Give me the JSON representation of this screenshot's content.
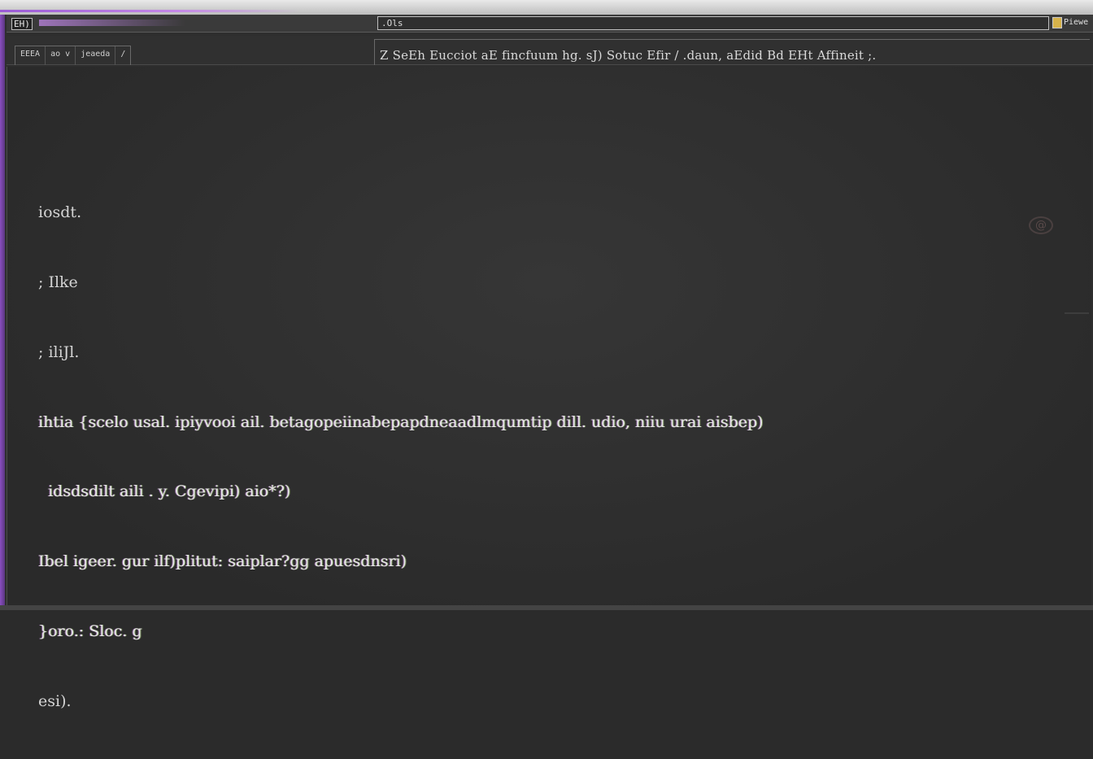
{
  "window": {
    "app_title": "EH)",
    "address": ".Ols",
    "corner_label": "Piewe"
  },
  "menu": {
    "items": [
      "EEEA",
      "ao v",
      "jeaeda",
      "/"
    ]
  },
  "tab": {
    "title": "Z SeEh Eucciot aE fincfuum hg. sJ) Sotuc Efir / .daun, aEdid Bd EHt Affineit ;."
  },
  "terminal": {
    "lines": [
      "iosdt.",
      "; Ilke",
      "; iliJl.",
      "ihtia {scelo usal. ipiyvooi ail. betagopeiinabepapdneaadlmqumtip dill. udio, niiu urai aisbep)",
      "  idsdsdilt aili . y. Cgevipi) aio*?)",
      "Ibel igeer. gur ilf)plitut: saiplar?gg apuesdnsri)",
      "}oro.: Sloc. g",
      "esi)."
    ],
    "highlight_line_indexes": [
      3,
      4,
      5,
      6
    ]
  },
  "colors": {
    "accent": "#9b5bd6",
    "background": "#2e2e2e",
    "text": "#d4d4d4"
  },
  "icons": {
    "side": "spiral-icon"
  }
}
